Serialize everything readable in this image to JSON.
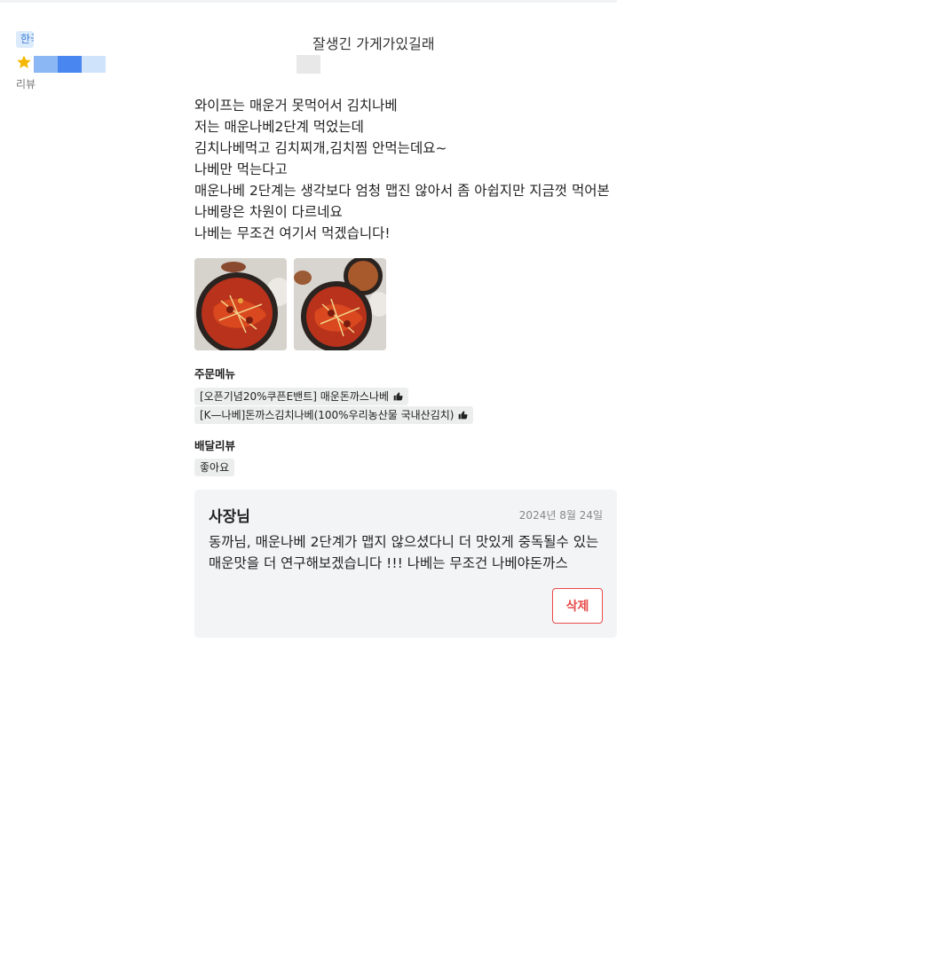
{
  "header": {
    "language_badge": "한국어",
    "title_fragment": "잘생긴 가게가있길래",
    "review_count_label": "리뷰"
  },
  "review": {
    "lines": [
      "와이프는 매운거 못먹어서 김치나베",
      "저는 매운나베2단계 먹었는데",
      "김치나베먹고 김치찌개,김치찜 안먹는데요~",
      "나베만 먹는다고",
      "매운나베 2단계는 생각보다 엄청 맵진 않아서 좀 아쉽지만 지금껏 먹어본",
      "나베랑은 차원이 다르네요",
      "나베는 무조건 여기서 먹겠습니다!"
    ],
    "photos": [
      "food-photo-1",
      "food-photo-2"
    ]
  },
  "order_menu": {
    "label": "주문메뉴",
    "items": [
      "[오픈기념20%쿠픈E밴트] 매운돈까스나베",
      "[K—나베]돈까스김치나베(100%우리농산물 국내산김치)"
    ]
  },
  "delivery_review": {
    "label": "배달리뷰",
    "value": "좋아요"
  },
  "owner_reply": {
    "author": "사장님",
    "date": "2024년 8월 24일",
    "text_lines": [
      "동까님, 매운나베 2단계가 맵지 않으셨다니 더 맛있게 중독될수 있는",
      "매운맛을 더 연구해보겠습니다 !!! 나베는 무조건 나베야돈까스"
    ],
    "delete_label": "삭제"
  },
  "colors": {
    "accent_red": "#e84a4a",
    "star": "#f5b800",
    "reply_bg": "#f3f4f6",
    "chip_bg": "#eceded"
  },
  "icons": {
    "star": "star-icon",
    "thumbs_up": "thumbs-up-icon"
  }
}
